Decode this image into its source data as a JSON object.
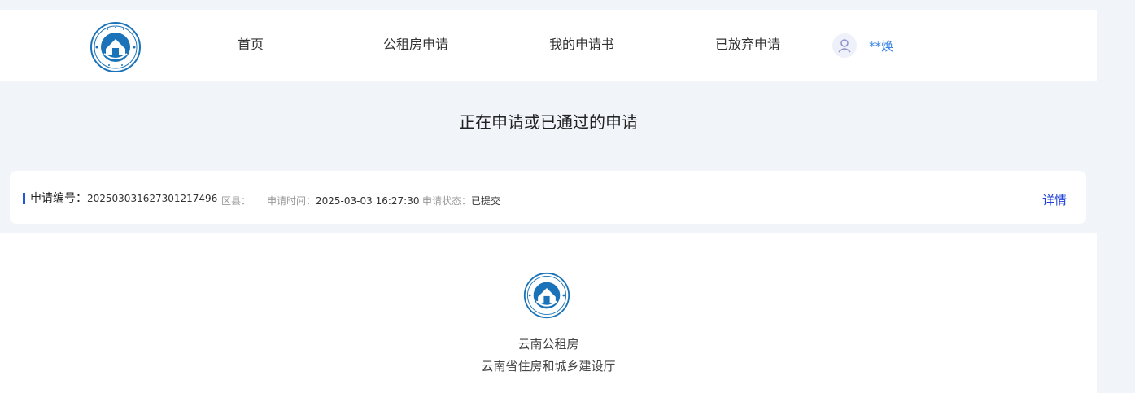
{
  "nav": {
    "home": "首页",
    "apply": "公租房申请",
    "my_applications": "我的申请书",
    "abandoned": "已放弃申请"
  },
  "user": {
    "name": "**焕",
    "icon": "user-icon"
  },
  "section_title": "正在申请或已通过的申请",
  "application": {
    "number_label": "申请编号：",
    "number_value": "20250303162730121 7496",
    "district_label": "区县：",
    "district_value": "",
    "time_label": "申请时间：",
    "time_value": "2025-03-03 16:27:30",
    "status_label": "申请状态：",
    "status_value": "已提交",
    "detail_link": "详情"
  },
  "footer": {
    "name": "云南公租房",
    "org": "云南省住房和城乡建设厅"
  },
  "colors": {
    "accent_blue": "#1f3fd8",
    "username_blue": "#3b86e6",
    "logo_blue": "#1a73b8",
    "background": "#f1f4f9"
  }
}
